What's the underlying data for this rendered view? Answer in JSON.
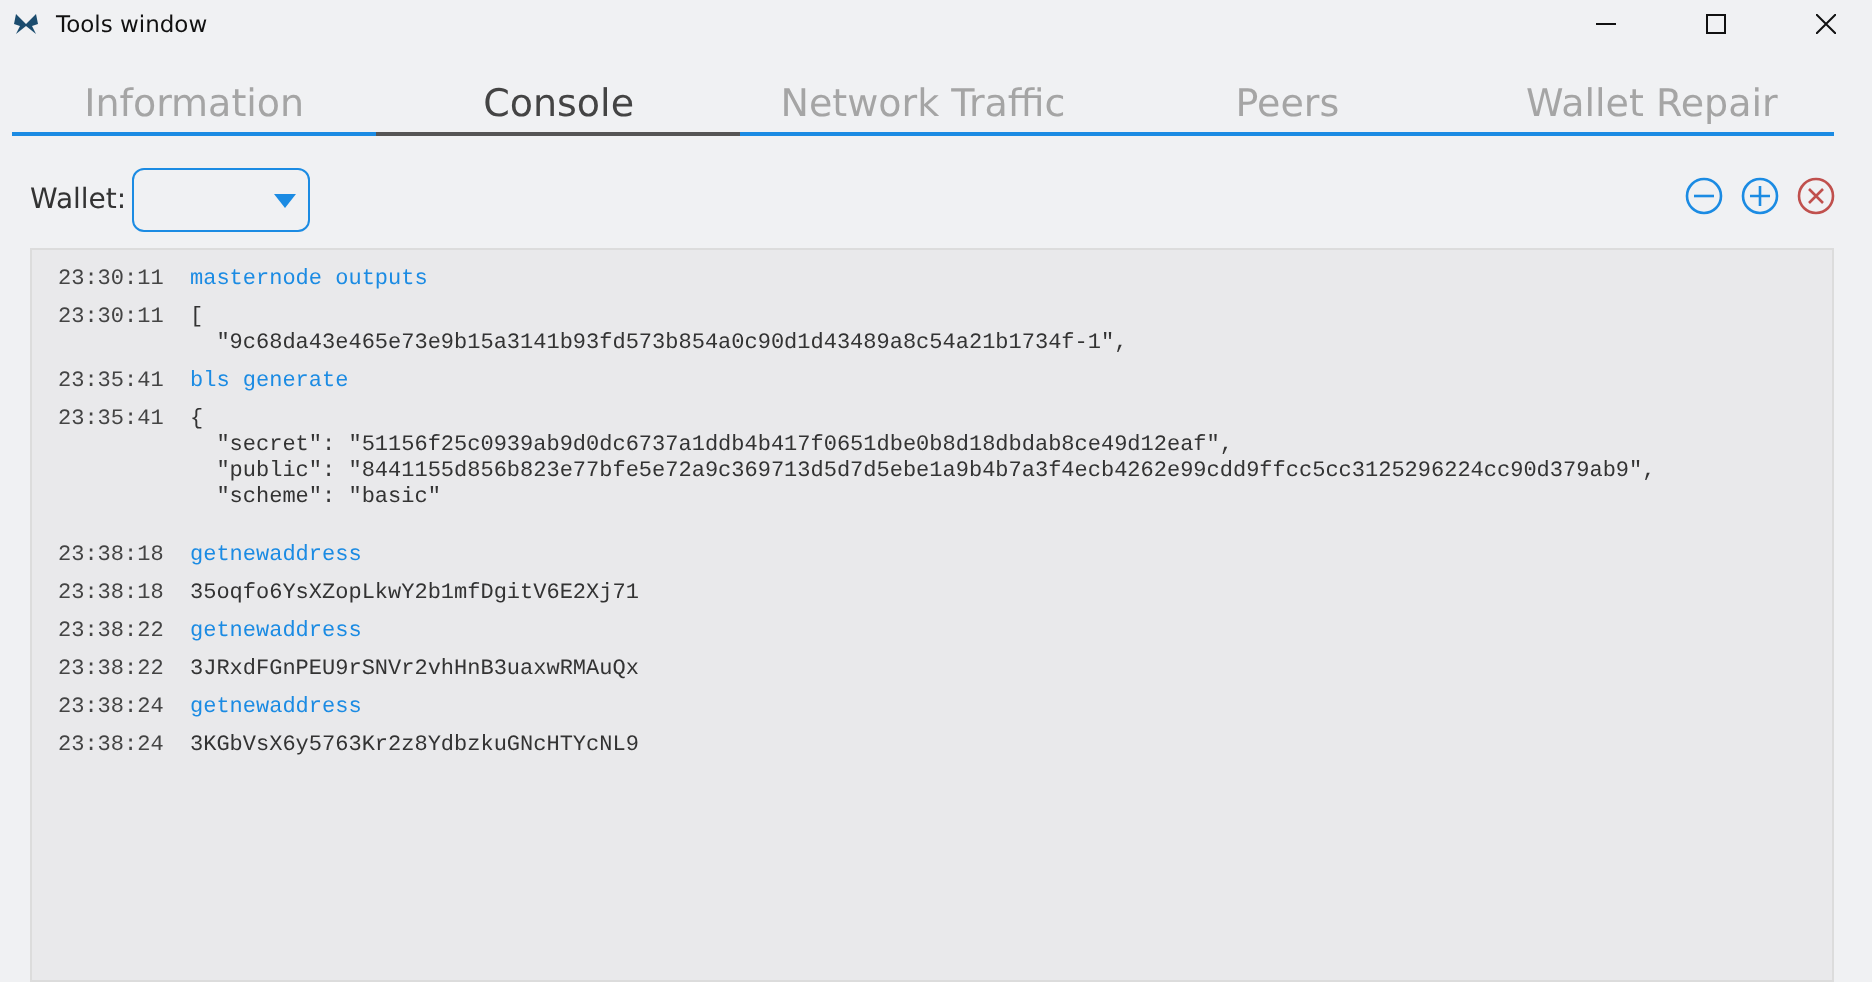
{
  "window": {
    "title": "Tools window"
  },
  "tabs": [
    {
      "label": "Information",
      "selected": false
    },
    {
      "label": "Console",
      "selected": true
    },
    {
      "label": "Network Traffic",
      "selected": false
    },
    {
      "label": "Peers",
      "selected": false
    },
    {
      "label": "Wallet Repair",
      "selected": false
    }
  ],
  "wallet": {
    "label": "Wallet:"
  },
  "console": [
    {
      "time": "23:30:11",
      "kind": "command",
      "lines": [
        "masternode outputs"
      ]
    },
    {
      "time": "23:30:11",
      "kind": "reply",
      "lines": [
        "[",
        "  \"9c68da43e465e73e9b15a3141b93fd573b854a0c90d1d43489a8c54a21b1734f-1\","
      ]
    },
    {
      "time": "23:35:41",
      "kind": "command",
      "lines": [
        "bls generate"
      ]
    },
    {
      "time": "23:35:41",
      "kind": "reply",
      "lines": [
        "{",
        "  \"secret\": \"51156f25c0939ab9d0dc6737a1ddb4b417f0651dbe0b8d18dbdab8ce49d12eaf\",",
        "  \"public\": \"8441155d856b823e77bfe5e72a9c369713d5d7d5ebe1a9b4b7a3f4ecb4262e99cdd9ffcc5cc3125296224cc90d379ab9\",",
        "  \"scheme\": \"basic\""
      ]
    },
    {
      "time": "23:38:18",
      "kind": "command",
      "lines": [
        "getnewaddress"
      ]
    },
    {
      "time": "23:38:18",
      "kind": "reply",
      "lines": [
        "35oqfo6YsXZopLkwY2b1mfDgitV6E2Xj71"
      ]
    },
    {
      "time": "23:38:22",
      "kind": "command",
      "lines": [
        "getnewaddress"
      ]
    },
    {
      "time": "23:38:22",
      "kind": "reply",
      "lines": [
        "3JRxdFGnPEU9rSNVr2vhHnB3uaxwRMAuQx"
      ]
    },
    {
      "time": "23:38:24",
      "kind": "command",
      "lines": [
        "getnewaddress"
      ]
    },
    {
      "time": "23:38:24",
      "kind": "reply",
      "lines": [
        "3KGbVsX6y5763Kr2z8YdbzkuGNcHTYcNL9"
      ]
    }
  ]
}
